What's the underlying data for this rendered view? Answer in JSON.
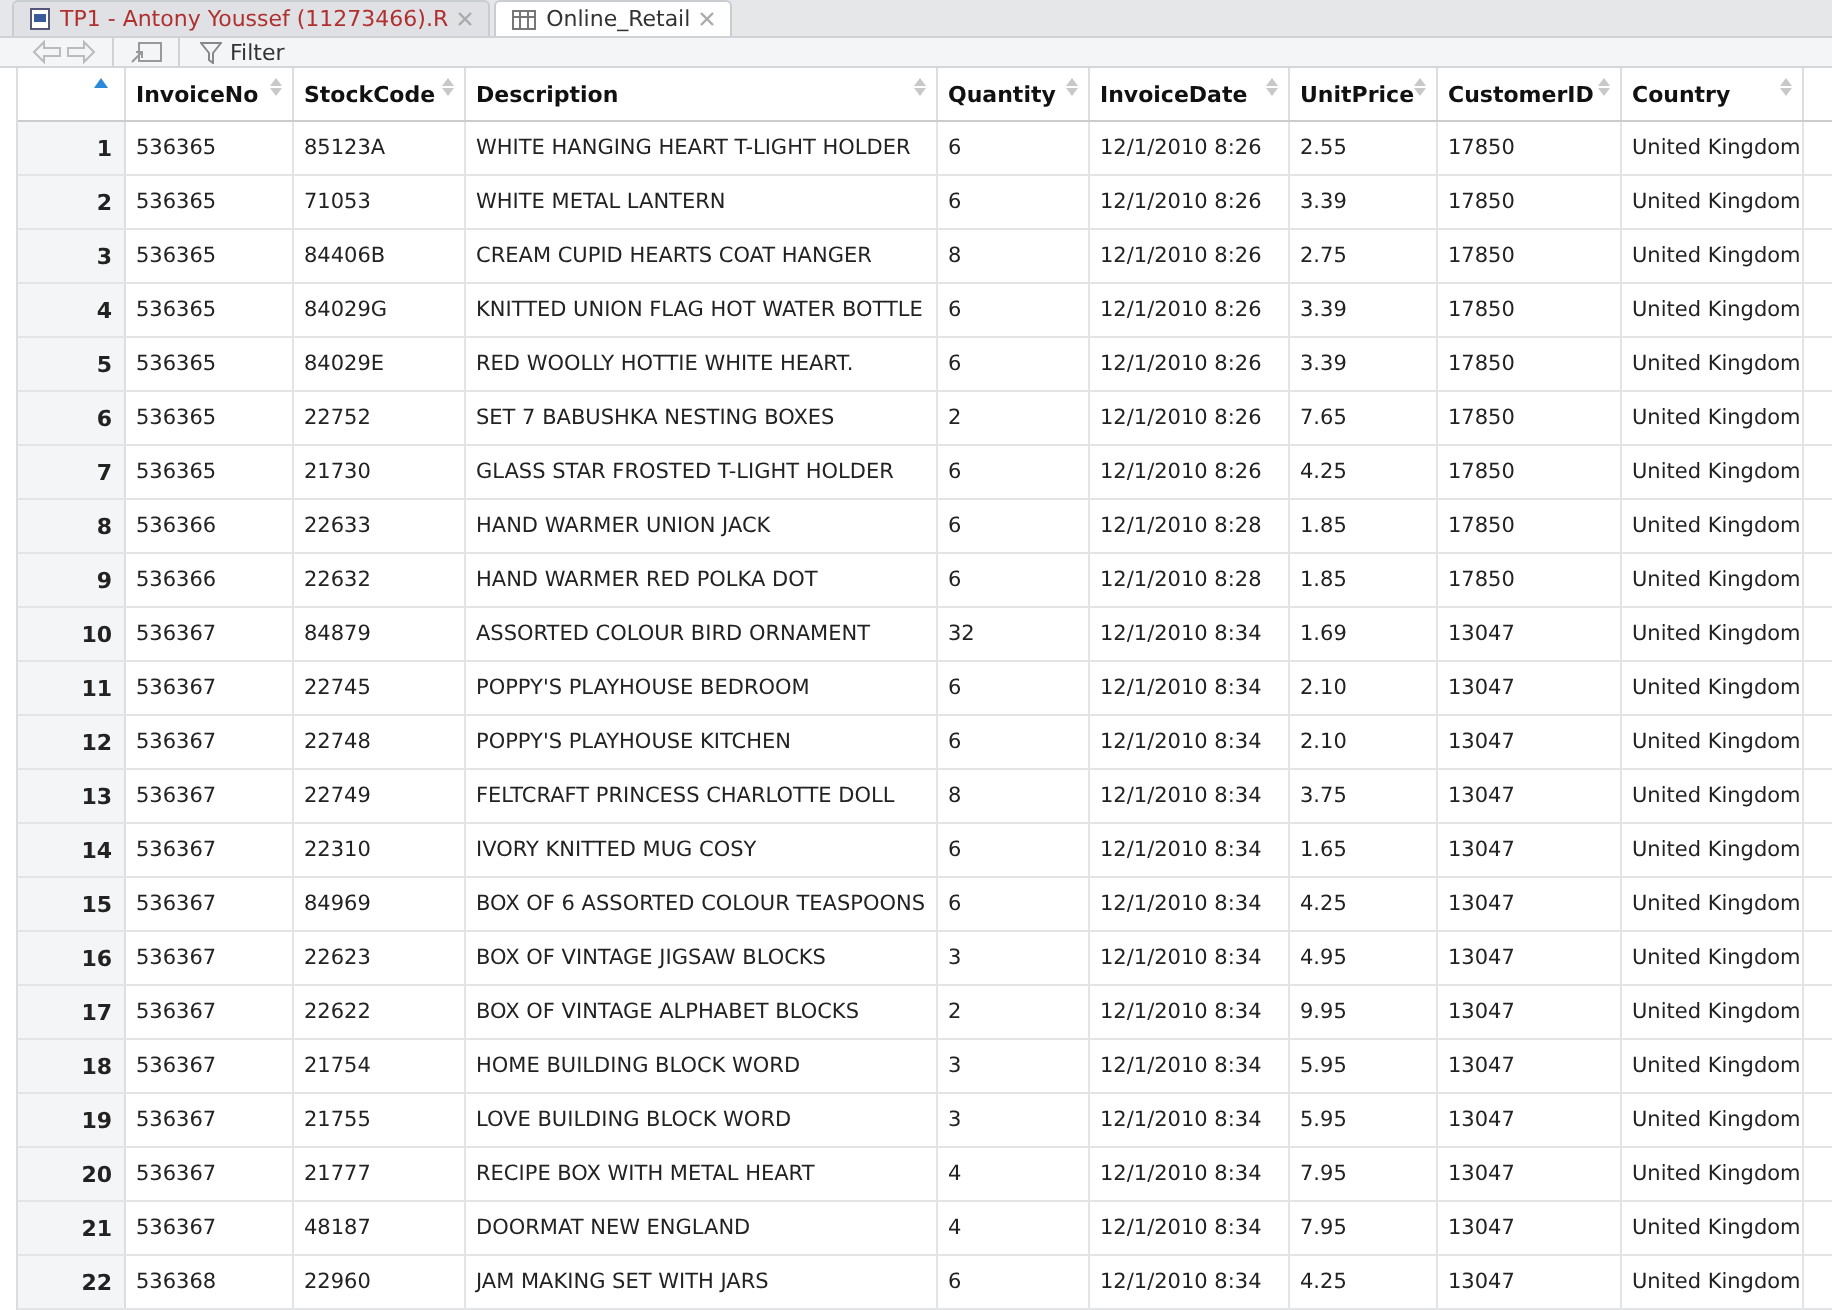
{
  "tabs": [
    {
      "label": "TP1 - Antony Youssef (11273466).R",
      "kind": "script",
      "selected": false
    },
    {
      "label": "Online_Retail",
      "kind": "data",
      "selected": true
    }
  ],
  "toolbar": {
    "filter_label": "Filter"
  },
  "table": {
    "index_sorted": true,
    "columns": [
      {
        "label": "InvoiceNo",
        "sorted": false
      },
      {
        "label": "StockCode",
        "sorted": false
      },
      {
        "label": "Description",
        "sorted": false
      },
      {
        "label": "Quantity",
        "sorted": false
      },
      {
        "label": "InvoiceDate",
        "sorted": false
      },
      {
        "label": "UnitPrice",
        "sorted": false
      },
      {
        "label": "CustomerID",
        "sorted": false
      },
      {
        "label": "Country",
        "sorted": false
      }
    ],
    "rows": [
      {
        "index": "1",
        "cells": [
          "536365",
          "85123A",
          "WHITE HANGING HEART T-LIGHT HOLDER",
          "6",
          "12/1/2010 8:26",
          "2.55",
          "17850",
          "United Kingdom"
        ]
      },
      {
        "index": "2",
        "cells": [
          "536365",
          "71053",
          "WHITE METAL LANTERN",
          "6",
          "12/1/2010 8:26",
          "3.39",
          "17850",
          "United Kingdom"
        ]
      },
      {
        "index": "3",
        "cells": [
          "536365",
          "84406B",
          "CREAM CUPID HEARTS COAT HANGER",
          "8",
          "12/1/2010 8:26",
          "2.75",
          "17850",
          "United Kingdom"
        ]
      },
      {
        "index": "4",
        "cells": [
          "536365",
          "84029G",
          "KNITTED UNION FLAG HOT WATER BOTTLE",
          "6",
          "12/1/2010 8:26",
          "3.39",
          "17850",
          "United Kingdom"
        ]
      },
      {
        "index": "5",
        "cells": [
          "536365",
          "84029E",
          "RED WOOLLY HOTTIE WHITE HEART.",
          "6",
          "12/1/2010 8:26",
          "3.39",
          "17850",
          "United Kingdom"
        ]
      },
      {
        "index": "6",
        "cells": [
          "536365",
          "22752",
          "SET 7 BABUSHKA NESTING BOXES",
          "2",
          "12/1/2010 8:26",
          "7.65",
          "17850",
          "United Kingdom"
        ]
      },
      {
        "index": "7",
        "cells": [
          "536365",
          "21730",
          "GLASS STAR FROSTED T-LIGHT HOLDER",
          "6",
          "12/1/2010 8:26",
          "4.25",
          "17850",
          "United Kingdom"
        ]
      },
      {
        "index": "8",
        "cells": [
          "536366",
          "22633",
          "HAND WARMER UNION JACK",
          "6",
          "12/1/2010 8:28",
          "1.85",
          "17850",
          "United Kingdom"
        ]
      },
      {
        "index": "9",
        "cells": [
          "536366",
          "22632",
          "HAND WARMER RED POLKA DOT",
          "6",
          "12/1/2010 8:28",
          "1.85",
          "17850",
          "United Kingdom"
        ]
      },
      {
        "index": "10",
        "cells": [
          "536367",
          "84879",
          "ASSORTED COLOUR BIRD ORNAMENT",
          "32",
          "12/1/2010 8:34",
          "1.69",
          "13047",
          "United Kingdom"
        ]
      },
      {
        "index": "11",
        "cells": [
          "536367",
          "22745",
          "POPPY'S PLAYHOUSE BEDROOM",
          "6",
          "12/1/2010 8:34",
          "2.10",
          "13047",
          "United Kingdom"
        ]
      },
      {
        "index": "12",
        "cells": [
          "536367",
          "22748",
          "POPPY'S PLAYHOUSE KITCHEN",
          "6",
          "12/1/2010 8:34",
          "2.10",
          "13047",
          "United Kingdom"
        ]
      },
      {
        "index": "13",
        "cells": [
          "536367",
          "22749",
          "FELTCRAFT PRINCESS CHARLOTTE DOLL",
          "8",
          "12/1/2010 8:34",
          "3.75",
          "13047",
          "United Kingdom"
        ]
      },
      {
        "index": "14",
        "cells": [
          "536367",
          "22310",
          "IVORY KNITTED MUG COSY",
          "6",
          "12/1/2010 8:34",
          "1.65",
          "13047",
          "United Kingdom"
        ]
      },
      {
        "index": "15",
        "cells": [
          "536367",
          "84969",
          "BOX OF 6 ASSORTED COLOUR TEASPOONS",
          "6",
          "12/1/2010 8:34",
          "4.25",
          "13047",
          "United Kingdom"
        ]
      },
      {
        "index": "16",
        "cells": [
          "536367",
          "22623",
          "BOX OF VINTAGE JIGSAW BLOCKS",
          "3",
          "12/1/2010 8:34",
          "4.95",
          "13047",
          "United Kingdom"
        ]
      },
      {
        "index": "17",
        "cells": [
          "536367",
          "22622",
          "BOX OF VINTAGE ALPHABET BLOCKS",
          "2",
          "12/1/2010 8:34",
          "9.95",
          "13047",
          "United Kingdom"
        ]
      },
      {
        "index": "18",
        "cells": [
          "536367",
          "21754",
          "HOME BUILDING BLOCK WORD",
          "3",
          "12/1/2010 8:34",
          "5.95",
          "13047",
          "United Kingdom"
        ]
      },
      {
        "index": "19",
        "cells": [
          "536367",
          "21755",
          "LOVE BUILDING BLOCK WORD",
          "3",
          "12/1/2010 8:34",
          "5.95",
          "13047",
          "United Kingdom"
        ]
      },
      {
        "index": "20",
        "cells": [
          "536367",
          "21777",
          "RECIPE BOX WITH METAL HEART",
          "4",
          "12/1/2010 8:34",
          "7.95",
          "13047",
          "United Kingdom"
        ]
      },
      {
        "index": "21",
        "cells": [
          "536367",
          "48187",
          "DOORMAT NEW ENGLAND",
          "4",
          "12/1/2010 8:34",
          "7.95",
          "13047",
          "United Kingdom"
        ]
      },
      {
        "index": "22",
        "cells": [
          "536368",
          "22960",
          "JAM MAKING SET WITH JARS",
          "6",
          "12/1/2010 8:34",
          "4.25",
          "13047",
          "United Kingdom"
        ]
      }
    ]
  }
}
